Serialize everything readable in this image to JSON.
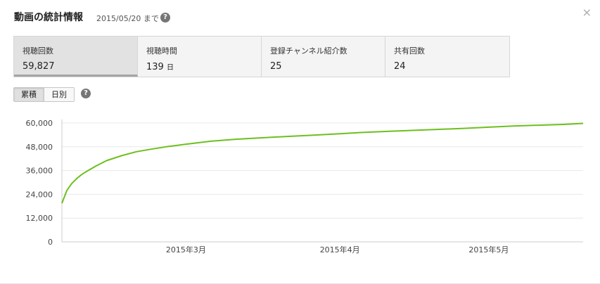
{
  "header": {
    "title": "動画の統計情報",
    "date_note": "2015/05/20 まで",
    "help_glyph": "?",
    "close_glyph": "×"
  },
  "stats": [
    {
      "label": "視聴回数",
      "value": "59,827",
      "unit": ""
    },
    {
      "label": "視聴時間",
      "value": "139",
      "unit": "日"
    },
    {
      "label": "登録チャンネル紹介数",
      "value": "25",
      "unit": ""
    },
    {
      "label": "共有回数",
      "value": "24",
      "unit": ""
    }
  ],
  "toggle": {
    "cumulative": "累積",
    "daily": "日別",
    "selected": "cumulative"
  },
  "colors": {
    "line": "#6dbf1e",
    "grid": "#e8e8e8",
    "axis": "#cccccc"
  },
  "chart_data": {
    "type": "line",
    "title": "",
    "xlabel": "",
    "ylabel": "",
    "ylim": [
      0,
      60000
    ],
    "yticks": [
      "60,000",
      "48,000",
      "36,000",
      "24,000",
      "12,000",
      "0"
    ],
    "ytick_values": [
      60000,
      48000,
      36000,
      24000,
      12000,
      0
    ],
    "xticks": [
      "2015年3月",
      "2015年4月",
      "2015年5月"
    ],
    "xtick_dates": [
      "2015-03-01",
      "2015-04-01",
      "2015-05-01"
    ],
    "xlim": [
      "2015-02-04",
      "2015-05-20"
    ],
    "grid": true,
    "legend": "none",
    "series": [
      {
        "x": [
          "2015-02-04",
          "2015-02-05",
          "2015-02-06",
          "2015-02-07",
          "2015-02-08",
          "2015-02-09",
          "2015-02-11",
          "2015-02-13",
          "2015-02-16",
          "2015-02-19",
          "2015-02-22",
          "2015-02-25",
          "2015-03-01",
          "2015-03-06",
          "2015-03-11",
          "2015-03-16",
          "2015-03-21",
          "2015-03-26",
          "2015-04-01",
          "2015-04-06",
          "2015-04-11",
          "2015-04-16",
          "2015-04-21",
          "2015-04-26",
          "2015-05-01",
          "2015-05-06",
          "2015-05-11",
          "2015-05-16",
          "2015-05-20"
        ],
        "values": [
          19500,
          26000,
          29500,
          32000,
          34000,
          35600,
          38500,
          41000,
          43500,
          45500,
          46800,
          48000,
          49300,
          50800,
          51800,
          52500,
          53200,
          53800,
          54600,
          55300,
          55800,
          56300,
          56800,
          57300,
          57900,
          58500,
          58900,
          59300,
          59827
        ]
      }
    ]
  }
}
